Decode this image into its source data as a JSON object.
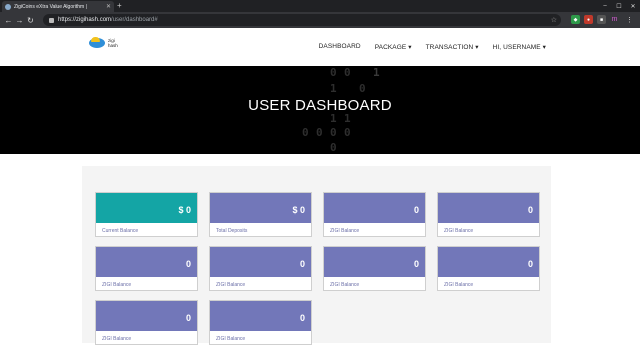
{
  "browser": {
    "tab_title": "ZigiCoins eXtra Value Algorithm |",
    "new_tab": "+",
    "url_host": "https://zigihash.com",
    "url_path": "/user/dashboard#"
  },
  "site": {
    "logo_line1": "zigi",
    "logo_line2": "hash",
    "nav": [
      "DASHBOARD",
      "PACKAGE ▾",
      "TRANSACTION ▾",
      "HI, USERNAME ▾"
    ]
  },
  "hero": {
    "title": "USER DASHBOARD",
    "binary": [
      "0",
      "0",
      "1",
      "1",
      "0",
      "1",
      "1",
      "0",
      "0",
      "0",
      "0",
      "0"
    ]
  },
  "cards": [
    {
      "value": "$ 0",
      "label": "Current Balance",
      "accent": "#14a5a5"
    },
    {
      "value": "$ 0",
      "label": "Total Deposits",
      "accent": "#7277b9"
    },
    {
      "value": "0",
      "label": "ZIGI Balance",
      "accent": "#7277b9"
    },
    {
      "value": "0",
      "label": "ZIGI Balance",
      "accent": "#7277b9"
    },
    {
      "value": "0",
      "label": "ZIGI Balance",
      "accent": "#7277b9"
    },
    {
      "value": "0",
      "label": "ZIGI Balance",
      "accent": "#7277b9"
    },
    {
      "value": "0",
      "label": "ZIGI Balance",
      "accent": "#7277b9"
    },
    {
      "value": "0",
      "label": "ZIGI Balance",
      "accent": "#7277b9"
    },
    {
      "value": "0",
      "label": "ZIGI Balance",
      "accent": "#7277b9"
    },
    {
      "value": "0",
      "label": "ZIGI Balance",
      "accent": "#7277b9"
    }
  ]
}
